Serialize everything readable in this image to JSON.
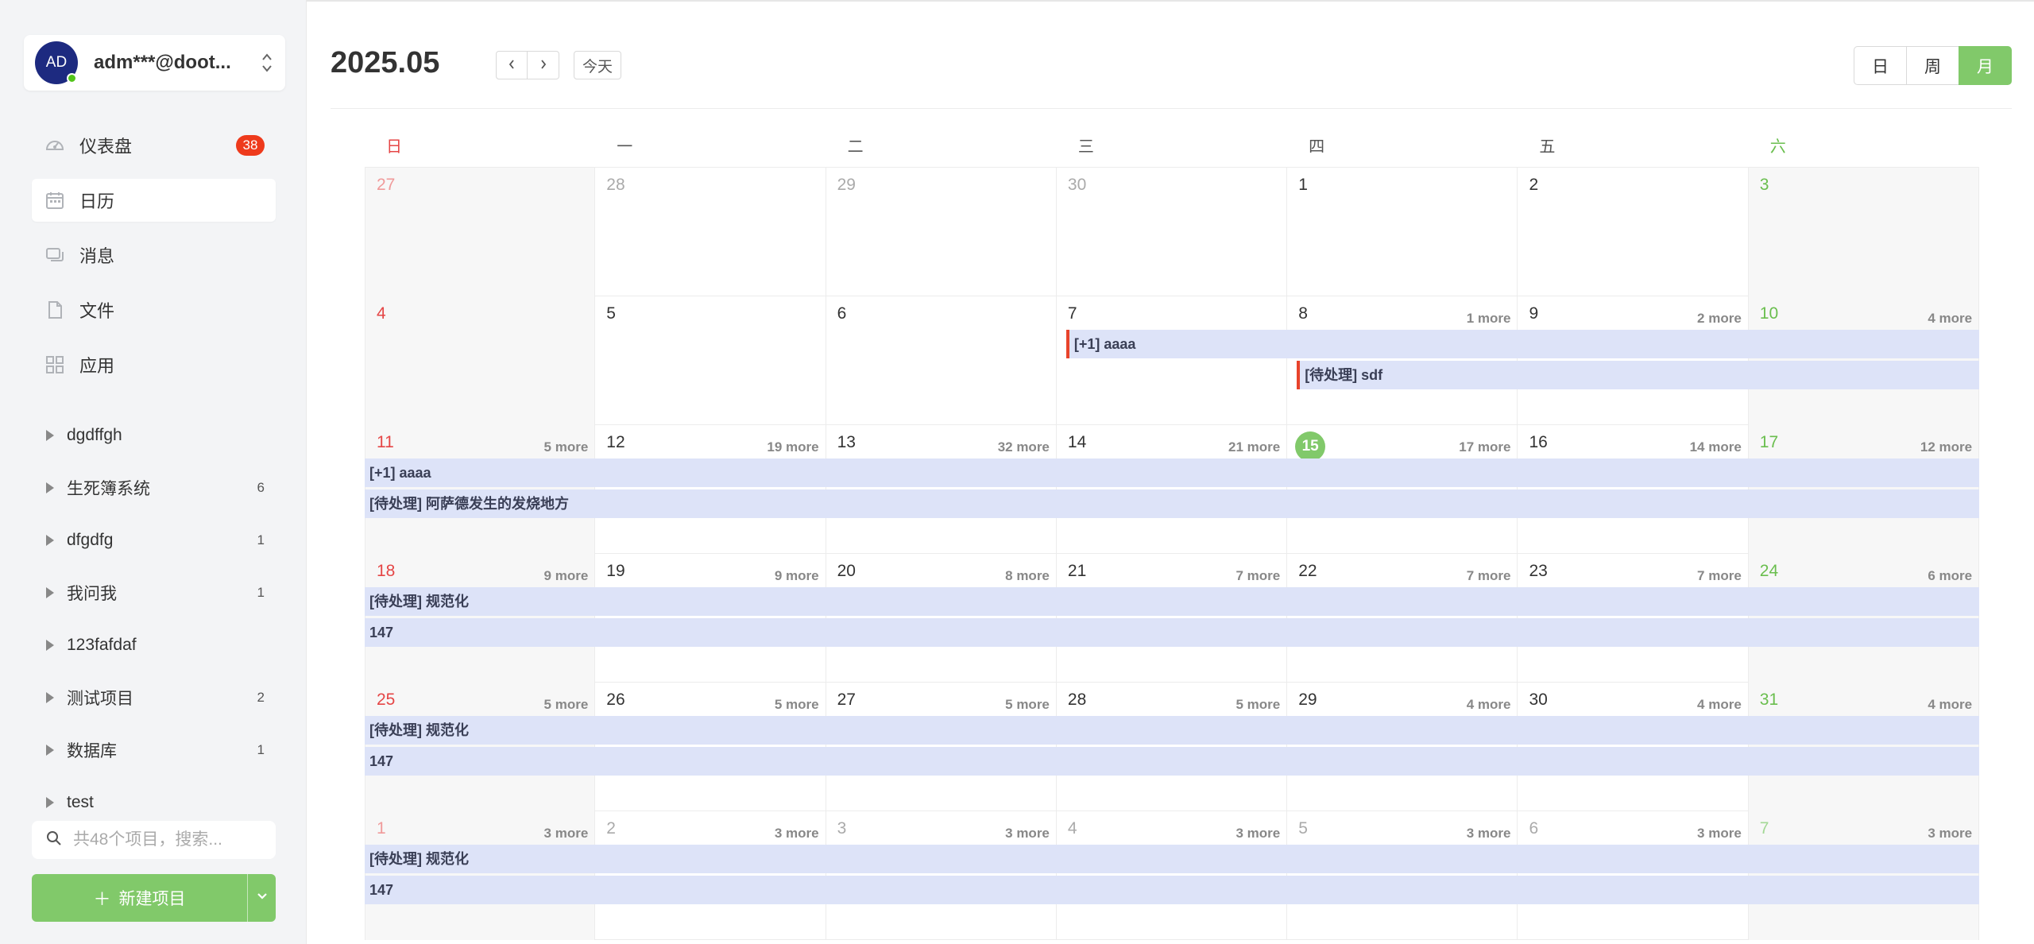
{
  "user": {
    "initials": "AD",
    "name": "adm***@doot..."
  },
  "nav": [
    {
      "label": "仪表盘",
      "badge": "38",
      "icon": "dashboard-icon"
    },
    {
      "label": "日历",
      "icon": "calendar-icon",
      "active": true
    },
    {
      "label": "消息",
      "icon": "message-icon"
    },
    {
      "label": "文件",
      "icon": "file-icon"
    },
    {
      "label": "应用",
      "icon": "apps-icon"
    }
  ],
  "projects": [
    {
      "name": "dgdffgh",
      "count": ""
    },
    {
      "name": "生死簿系统",
      "count": "6"
    },
    {
      "name": "dfgdfg",
      "count": "1"
    },
    {
      "name": "我问我",
      "count": "1"
    },
    {
      "name": "123fafdaf",
      "count": ""
    },
    {
      "name": "测试项目",
      "count": "2"
    },
    {
      "name": "数据库",
      "count": "1"
    },
    {
      "name": "test",
      "count": ""
    }
  ],
  "search": {
    "placeholder": "共48个项目，搜索..."
  },
  "new_project": {
    "label": "新建项目"
  },
  "header": {
    "month": "2025.05",
    "today": "今天",
    "views": [
      {
        "label": "日",
        "active": false
      },
      {
        "label": "周",
        "active": false
      },
      {
        "label": "月",
        "active": true
      }
    ]
  },
  "weekdays": [
    "日",
    "一",
    "二",
    "三",
    "四",
    "五",
    "六"
  ],
  "weeks": [
    {
      "days": [
        {
          "d": "27",
          "other": true,
          "more": ""
        },
        {
          "d": "28",
          "other": true,
          "more": ""
        },
        {
          "d": "29",
          "other": true,
          "more": ""
        },
        {
          "d": "30",
          "other": true,
          "more": ""
        },
        {
          "d": "1",
          "more": ""
        },
        {
          "d": "2",
          "more": ""
        },
        {
          "d": "3",
          "more": ""
        }
      ],
      "events": []
    },
    {
      "days": [
        {
          "d": "4",
          "more": ""
        },
        {
          "d": "5",
          "more": ""
        },
        {
          "d": "6",
          "more": ""
        },
        {
          "d": "7",
          "more": ""
        },
        {
          "d": "8",
          "more": "1 more"
        },
        {
          "d": "9",
          "more": "2 more"
        },
        {
          "d": "10",
          "more": "4 more"
        }
      ],
      "events": [
        {
          "label": "[+1] aaaa",
          "start": 3,
          "row": 0,
          "bar": true
        },
        {
          "label": "[待处理] sdf",
          "start": 4,
          "row": 1,
          "bar": true
        }
      ]
    },
    {
      "days": [
        {
          "d": "11",
          "more": "5 more"
        },
        {
          "d": "12",
          "more": "19 more"
        },
        {
          "d": "13",
          "more": "32 more"
        },
        {
          "d": "14",
          "more": "21 more"
        },
        {
          "d": "15",
          "more": "17 more",
          "today": true
        },
        {
          "d": "16",
          "more": "14 more"
        },
        {
          "d": "17",
          "more": "12 more"
        }
      ],
      "events": [
        {
          "label": "[+1] aaaa",
          "start": 0,
          "row": 0
        },
        {
          "label": "[待处理] 阿萨德发生的发烧地方",
          "start": 0,
          "row": 1
        }
      ]
    },
    {
      "days": [
        {
          "d": "18",
          "more": "9 more"
        },
        {
          "d": "19",
          "more": "9 more"
        },
        {
          "d": "20",
          "more": "8 more"
        },
        {
          "d": "21",
          "more": "7 more"
        },
        {
          "d": "22",
          "more": "7 more"
        },
        {
          "d": "23",
          "more": "7 more"
        },
        {
          "d": "24",
          "more": "6 more"
        }
      ],
      "events": [
        {
          "label": "[待处理] 规范化",
          "start": 0,
          "row": 0
        },
        {
          "label": "147",
          "start": 0,
          "row": 1
        }
      ]
    },
    {
      "days": [
        {
          "d": "25",
          "more": "5 more"
        },
        {
          "d": "26",
          "more": "5 more"
        },
        {
          "d": "27",
          "more": "5 more"
        },
        {
          "d": "28",
          "more": "5 more"
        },
        {
          "d": "29",
          "more": "4 more"
        },
        {
          "d": "30",
          "more": "4 more"
        },
        {
          "d": "31",
          "more": "4 more"
        }
      ],
      "events": [
        {
          "label": "[待处理] 规范化",
          "start": 0,
          "row": 0
        },
        {
          "label": "147",
          "start": 0,
          "row": 1
        }
      ]
    },
    {
      "days": [
        {
          "d": "1",
          "other": true,
          "more": "3 more"
        },
        {
          "d": "2",
          "other": true,
          "more": "3 more"
        },
        {
          "d": "3",
          "other": true,
          "more": "3 more"
        },
        {
          "d": "4",
          "other": true,
          "more": "3 more"
        },
        {
          "d": "5",
          "other": true,
          "more": "3 more"
        },
        {
          "d": "6",
          "other": true,
          "more": "3 more"
        },
        {
          "d": "7",
          "other": true,
          "more": "3 more"
        }
      ],
      "events": [
        {
          "label": "[待处理] 规范化",
          "start": 0,
          "row": 0
        },
        {
          "label": "147",
          "start": 0,
          "row": 1
        }
      ]
    }
  ],
  "colors": {
    "accent": "#81c96a",
    "sunday": "#e54646",
    "saturday": "#6abe4e",
    "event_bg": "#dde3f8",
    "event_marker": "#e8432b",
    "badge": "#ee3a1c"
  }
}
